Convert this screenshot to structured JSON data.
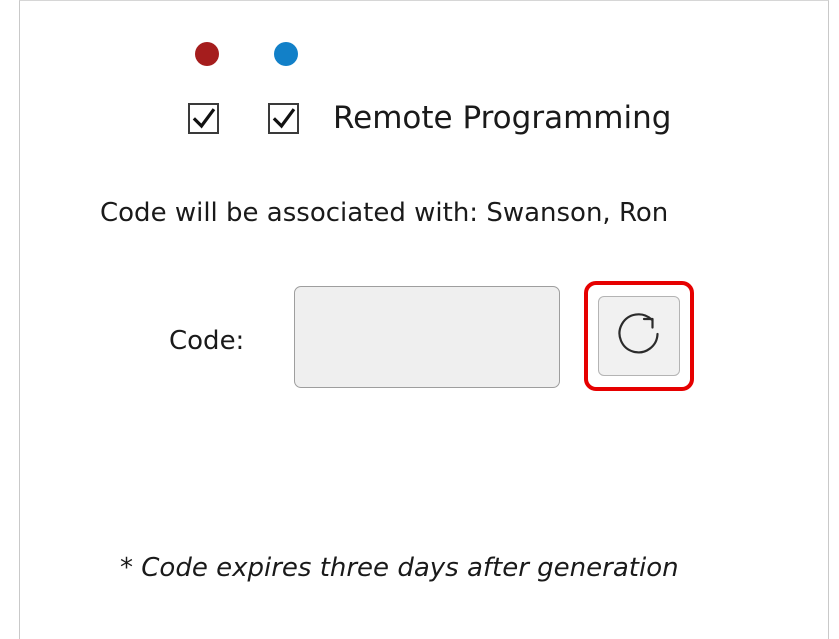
{
  "colors": {
    "red_indicator": "#a51d1d",
    "blue_indicator": "#1280c8",
    "highlight": "#e60000"
  },
  "indicators": [
    {
      "name": "red-dot",
      "color": "#a51d1d"
    },
    {
      "name": "blue-dot",
      "color": "#1280c8"
    }
  ],
  "checkboxes": [
    {
      "checked": true
    },
    {
      "checked": true
    }
  ],
  "remote_programming": {
    "label": "Remote Programming"
  },
  "association": {
    "text": "Code will be associated with: Swanson, Ron"
  },
  "code": {
    "label": "Code:",
    "value": "",
    "placeholder": ""
  },
  "refresh": {
    "icon": "refresh-icon"
  },
  "note": {
    "prefix": "* ",
    "text": "Code expires three days after generation"
  }
}
